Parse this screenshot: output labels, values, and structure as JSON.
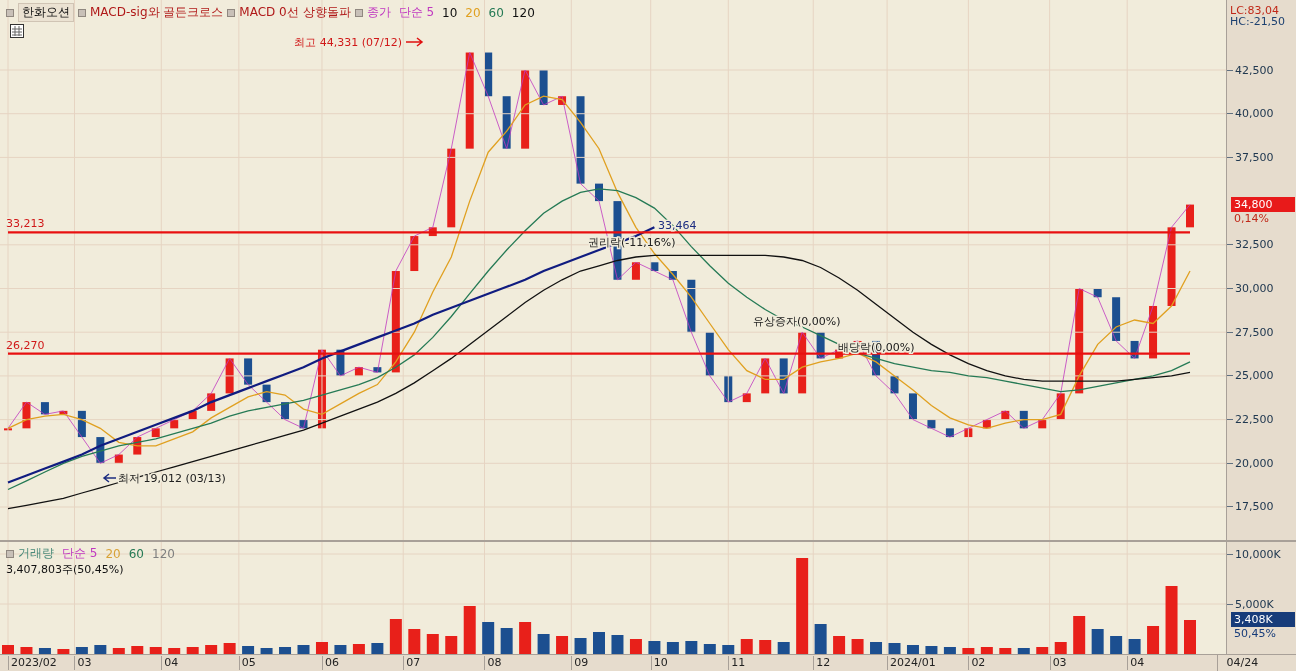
{
  "legend": {
    "symbol": "한화오션",
    "signals": [
      "MACD-sig와 골든크로스",
      "MACD 0선 상향돌파"
    ],
    "ma_items": [
      {
        "label": "단순 5",
        "color": "#c038c0"
      },
      {
        "label": "10",
        "color": "#101010"
      }
    ]
  },
  "indicators": {
    "lc": "LC:83,04",
    "hc": "HC:-21,50"
  },
  "price_chart": {
    "current_price": "34,800",
    "change": "0,14%",
    "chart_data": {
      "type": "line",
      "grid": true,
      "ylim": [
        15612,
        46505
      ],
      "yticks": [
        {
          "value": 17500,
          "label": "17,500"
        },
        {
          "value": 20000,
          "label": "20,000"
        },
        {
          "value": 22500,
          "label": "22,500"
        },
        {
          "value": 25000,
          "label": "25,000"
        },
        {
          "value": 27500,
          "label": "27,500"
        },
        {
          "value": 30000,
          "label": "30,000"
        },
        {
          "value": 32500,
          "label": "32,500"
        },
        {
          "value": 37500,
          "label": "37,500"
        },
        {
          "value": 40000,
          "label": "40,000"
        },
        {
          "value": 42500,
          "label": "42,500"
        }
      ],
      "series": [
        {
          "name": "종가",
          "color": "#c038c0",
          "values": [
            22000,
            23500,
            22800,
            23000,
            21500,
            20000,
            20500,
            21500,
            22000,
            22500,
            23000,
            24000,
            26000,
            24500,
            23500,
            22500,
            22000,
            26500,
            25000,
            25500,
            25200,
            31000,
            33000,
            33500,
            38000,
            43500,
            41000,
            38000,
            42500,
            40500,
            41000,
            36000,
            35000,
            30500,
            31500,
            31000,
            30500,
            27500,
            25000,
            23500,
            24000,
            26000,
            24000,
            27500,
            26000,
            26500,
            27000,
            25000,
            24000,
            22500,
            22000,
            21500,
            22000,
            22500,
            23000,
            22000,
            22500,
            24000,
            30000,
            29500,
            27000,
            26000,
            29000,
            33500,
            34800
          ]
        },
        {
          "name": "20",
          "color": "#e0a020",
          "values": [
            22000,
            22500,
            22700,
            22800,
            22500,
            22000,
            21200,
            21000,
            21000,
            21400,
            21800,
            22600,
            23200,
            23800,
            24100,
            23900,
            23100,
            22800,
            23400,
            24000,
            24500,
            25800,
            27500,
            29800,
            31800,
            35000,
            37800,
            39000,
            40500,
            41000,
            40800,
            39500,
            38000,
            35500,
            33500,
            32000,
            30800,
            29500,
            28000,
            26500,
            25300,
            24800,
            24800,
            25500,
            25800,
            26000,
            26300,
            25800,
            25000,
            24200,
            23300,
            22600,
            22200,
            22000,
            22300,
            22500,
            22500,
            22800,
            25000,
            26800,
            27800,
            28200,
            28000,
            29000,
            31000
          ]
        },
        {
          "name": "60",
          "color": "#257a55",
          "values": [
            18500,
            19000,
            19500,
            20000,
            20400,
            20700,
            21000,
            21200,
            21400,
            21700,
            22000,
            22300,
            22700,
            23000,
            23200,
            23400,
            23600,
            23900,
            24200,
            24500,
            24900,
            25500,
            26200,
            27200,
            28400,
            29700,
            31000,
            32200,
            33300,
            34300,
            35000,
            35500,
            35700,
            35600,
            35200,
            34600,
            33600,
            32400,
            31300,
            30300,
            29500,
            28800,
            28200,
            27800,
            27300,
            26800,
            26300,
            26000,
            25700,
            25500,
            25300,
            25200,
            25000,
            24900,
            24700,
            24500,
            24300,
            24100,
            24200,
            24400,
            24600,
            24800,
            25000,
            25300,
            25800
          ]
        },
        {
          "name": "120",
          "color": "#111111",
          "values": [
            17400,
            17600,
            17800,
            18000,
            18300,
            18600,
            18900,
            19200,
            19500,
            19800,
            20100,
            20400,
            20700,
            21000,
            21300,
            21600,
            21900,
            22300,
            22700,
            23100,
            23500,
            24000,
            24600,
            25300,
            26000,
            26800,
            27600,
            28400,
            29200,
            29900,
            30500,
            31000,
            31300,
            31600,
            31800,
            31900,
            31900,
            31900,
            31900,
            31900,
            31900,
            31900,
            31800,
            31600,
            31200,
            30600,
            29900,
            29100,
            28300,
            27500,
            26800,
            26200,
            25700,
            25300,
            25000,
            24800,
            24700,
            24700,
            24700,
            24700,
            24700,
            24800,
            24900,
            25000,
            25200
          ]
        },
        {
          "color": "#101c80",
          "values": [
            18900,
            19300,
            19700,
            20100,
            20500,
            21000,
            21400,
            21800,
            22200,
            22600,
            23000,
            23500,
            23900,
            24300,
            24700,
            25100,
            25500,
            26000,
            26400,
            26800,
            27200,
            27600,
            28000,
            28500,
            28900,
            29300,
            29700,
            30100,
            30500,
            31000,
            31400,
            31800,
            32200,
            32600,
            33000,
            33500,
            null,
            null,
            null,
            null,
            null,
            null,
            null,
            null,
            null,
            null,
            null,
            null,
            null,
            null,
            null,
            null,
            null,
            null,
            null,
            null,
            null,
            null,
            null,
            null,
            null,
            null,
            null,
            null,
            null
          ]
        },
        {
          "color": "#e81010",
          "values": [
            33213,
            33213,
            33213,
            33213,
            33213,
            33213,
            33213,
            33213,
            33213,
            33213,
            33213,
            33213,
            33213,
            33213,
            33213,
            33213,
            33213,
            33213,
            33213,
            33213,
            33213,
            33213,
            33213,
            33213,
            33213,
            33213,
            33213,
            33213,
            33213,
            33213,
            33213,
            33213,
            33213,
            33213,
            33213,
            33213,
            33213,
            33213,
            33213,
            33213,
            33213,
            33213,
            33213,
            33213,
            33213,
            33213,
            33213,
            33213,
            33213,
            33213,
            33213,
            33213,
            33213,
            33213,
            33213,
            33213,
            33213,
            33213,
            33213,
            33213,
            33213,
            33213,
            33213,
            33213,
            33213
          ]
        },
        {
          "color": "#e81010",
          "values": [
            26270,
            26270,
            26270,
            26270,
            26270,
            26270,
            26270,
            26270,
            26270,
            26270,
            26270,
            26270,
            26270,
            26270,
            26270,
            26270,
            26270,
            26270,
            26270,
            26270,
            26270,
            26270,
            26270,
            26270,
            26270,
            26270,
            26270,
            26270,
            26270,
            26270,
            26270,
            26270,
            26270,
            26270,
            26270,
            26270,
            26270,
            26270,
            26270,
            26270,
            26270,
            26270,
            26270,
            26270,
            26270,
            26270,
            26270,
            26270,
            26270,
            26270,
            26270,
            26270,
            26270,
            26270,
            26270,
            26270,
            26270,
            26270,
            26270,
            26270,
            26270,
            26270,
            26270,
            26270,
            26270
          ]
        }
      ],
      "annotations": [
        "33,213",
        "26,270",
        "33,464",
        "최고 44,331 (07/12)",
        "최저 19,012 (03/13)",
        "권리락(-11,16%)",
        "유상증자(0,00%)",
        "배당락(0,00%)"
      ]
    }
  },
  "volume_legend": {
    "items": [
      {
        "label": "단순 5",
        "color": "#c038c0"
      },
      {
        "label": "20",
        "color": "#d8a238"
      },
      {
        "label": "60",
        "color": "#257a55"
      },
      {
        "label": "120",
        "color": "#808080"
      }
    ],
    "reading": "3,407,803주(50,45%)"
  },
  "volume_chart": {
    "current_volume": "3,408K",
    "ratio": "50,45%",
    "chart_data": {
      "type": "bar",
      "grid": true,
      "ylim": [
        0,
        11200
      ],
      "yticks": [
        {
          "value": 5000,
          "label": "5,000K"
        },
        {
          "value": 10000,
          "label": "10,000K"
        }
      ],
      "series": [
        {
          "name": "거래량",
          "values": [
            900,
            700,
            600,
            500,
            700,
            900,
            600,
            800,
            700,
            600,
            700,
            900,
            1100,
            800,
            600,
            700,
            900,
            1200,
            900,
            1000,
            1100,
            3500,
            2500,
            2000,
            1800,
            4800,
            3200,
            2600,
            3200,
            2000,
            1800,
            1600,
            2200,
            1900,
            1500,
            1300,
            1200,
            1300,
            1000,
            900,
            1500,
            1400,
            1200,
            9600,
            3000,
            1800,
            1500,
            1200,
            1100,
            900,
            800,
            700,
            600,
            700,
            600,
            600,
            700,
            1200,
            3800,
            2500,
            1800,
            1500,
            2800,
            6800,
            3400
          ]
        }
      ]
    }
  },
  "x_axis": {
    "labels": [
      "2023/02",
      "03",
      "04",
      "05",
      "06",
      "07",
      "08",
      "09",
      "10",
      "11",
      "12",
      "2024/01",
      "02",
      "03",
      "04"
    ],
    "last_date": "04/24"
  }
}
